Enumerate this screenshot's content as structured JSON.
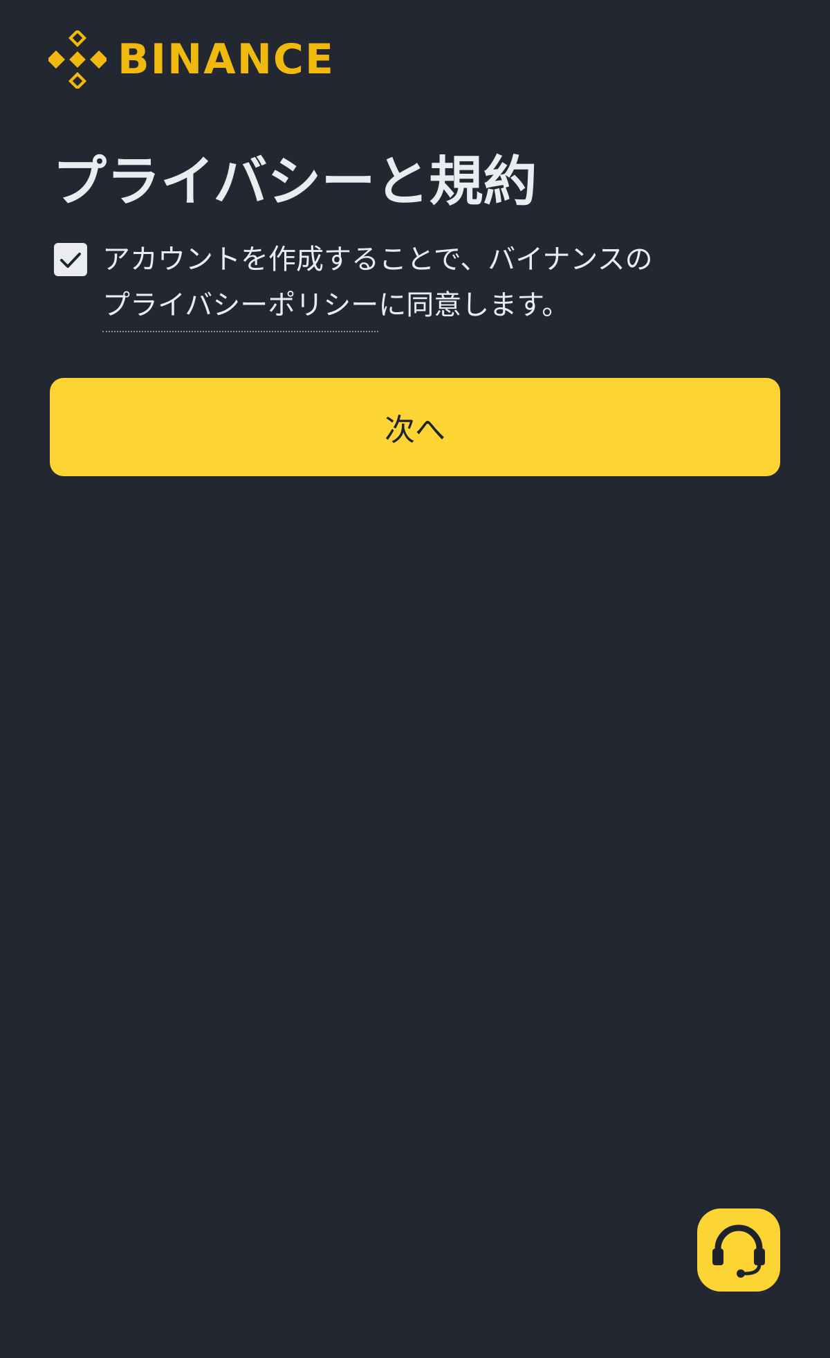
{
  "brand": {
    "name": "BINANCE",
    "color": "#F0B90B"
  },
  "page": {
    "title": "プライバシーと規約",
    "background": "#222731"
  },
  "consent": {
    "checked": true,
    "text_before": "アカウントを作成することで、バイナンスの",
    "link_label": "プライバシーポリシー",
    "text_after": "に同意します。"
  },
  "next_button": {
    "label": "次へ",
    "color": "#FCD535"
  },
  "support": {
    "icon": "headset-icon"
  }
}
